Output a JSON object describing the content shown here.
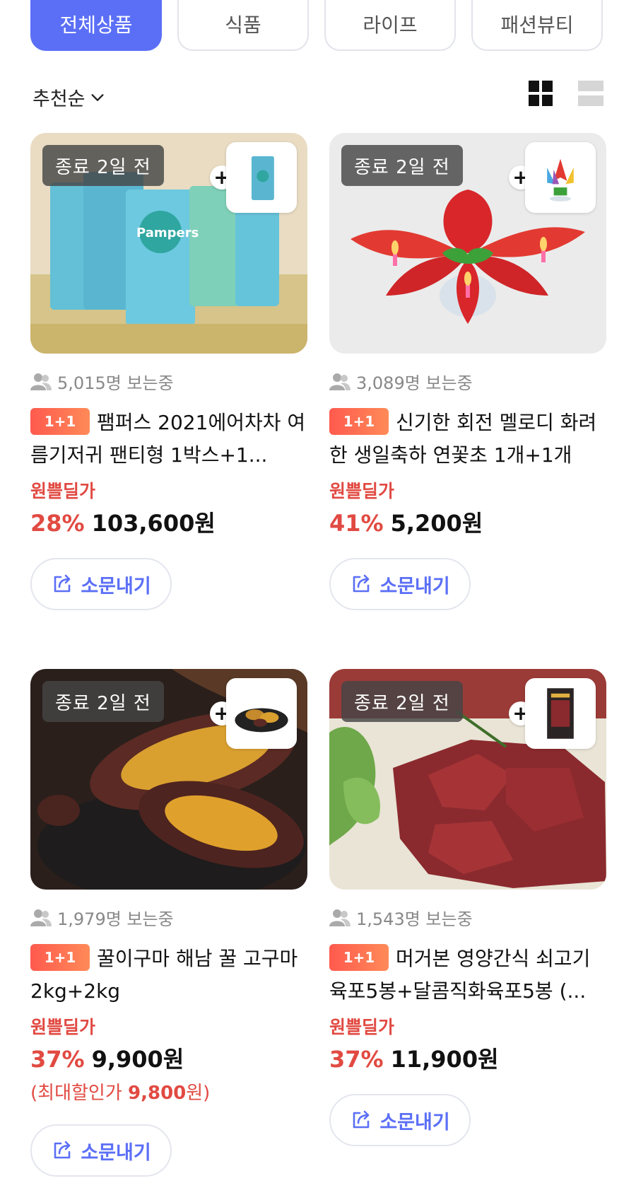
{
  "tabs": [
    {
      "label": "전체상품",
      "active": true
    },
    {
      "label": "식품",
      "active": false
    },
    {
      "label": "라이프",
      "active": false
    },
    {
      "label": "패션뷰티",
      "active": false
    }
  ],
  "sort": {
    "label": "추천순"
  },
  "accent_color": "#5b6ff6",
  "deal_color": "#e14a42",
  "products": [
    {
      "ends": "종료 2일 전",
      "viewers": "5,015명 보는중",
      "badge": "1+1",
      "title": "팸퍼스 2021에어차차 여름기저귀 팬티형 1박스+1...",
      "deal_label": "원쁠딜가",
      "discount": "28%",
      "price": "103,600원",
      "share": "소문내기"
    },
    {
      "ends": "종료 2일 전",
      "viewers": "3,089명 보는중",
      "badge": "1+1",
      "title": "신기한 회전 멜로디 화려한 생일축하 연꽃초 1개+1개",
      "deal_label": "원쁠딜가",
      "discount": "41%",
      "price": "5,200원",
      "share": "소문내기"
    },
    {
      "ends": "종료 2일 전",
      "viewers": "1,979명 보는중",
      "badge": "1+1",
      "title": "꿀이구마 해남 꿀 고구마 2kg+2kg",
      "deal_label": "원쁠딜가",
      "discount": "37%",
      "price": "9,900원",
      "max_discount_prefix": "(최대할인가 ",
      "max_discount_value": "9,800",
      "max_discount_suffix": "원)",
      "share": "소문내기"
    },
    {
      "ends": "종료 2일 전",
      "viewers": "1,543명 보는중",
      "badge": "1+1",
      "title": "머거본 영양간식 쇠고기 육포5봉+달콤직화육포5봉 (...",
      "deal_label": "원쁠딜가",
      "discount": "37%",
      "price": "11,900원",
      "share": "소문내기"
    }
  ]
}
